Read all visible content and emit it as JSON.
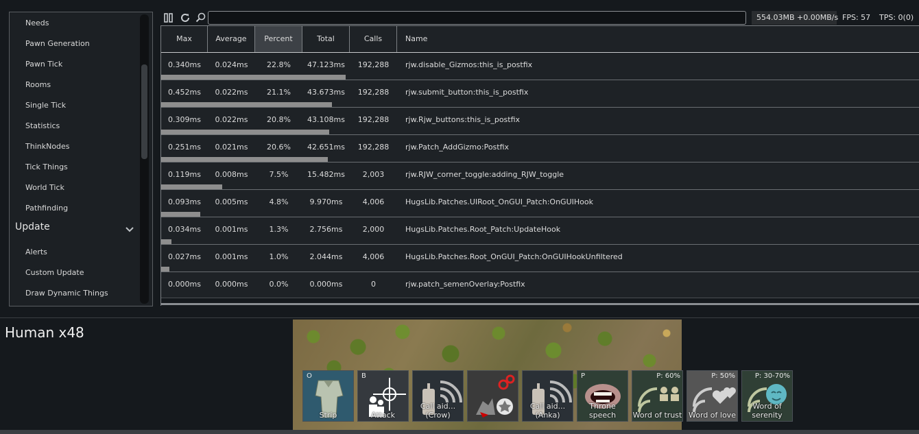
{
  "sidebar": {
    "items_top": [
      "Needs",
      "Pawn Generation",
      "Pawn Tick",
      "Rooms",
      "Single Tick",
      "Statistics",
      "ThinkNodes",
      "Tick Things",
      "World Tick",
      "Pathfinding"
    ],
    "section_header": "Update",
    "items_bottom": [
      "Alerts",
      "Custom Update",
      "Draw Dynamic Things"
    ]
  },
  "toolbar": {
    "search_value": "",
    "memory": "554.03MB +0.00MB/s",
    "fps": "FPS: 57",
    "tps": "TPS: 0(0)"
  },
  "table": {
    "columns": [
      "Max",
      "Average",
      "Percent",
      "Total",
      "Calls",
      "Name"
    ],
    "sorted_column": "Percent",
    "rows": [
      {
        "max": "0.340ms",
        "avg": "0.024ms",
        "pct": "22.8%",
        "total": "47.123ms",
        "calls": "192,288",
        "name": "rjw.disable_Gizmos:this_is_postfix",
        "bar": 22.8
      },
      {
        "max": "0.452ms",
        "avg": "0.022ms",
        "pct": "21.1%",
        "total": "43.673ms",
        "calls": "192,288",
        "name": "rjw.submit_button:this_is_postfix",
        "bar": 21.1
      },
      {
        "max": "0.309ms",
        "avg": "0.022ms",
        "pct": "20.8%",
        "total": "43.108ms",
        "calls": "192,288",
        "name": "rjw.Rjw_buttons:this_is_postfix",
        "bar": 20.8
      },
      {
        "max": "0.251ms",
        "avg": "0.021ms",
        "pct": "20.6%",
        "total": "42.651ms",
        "calls": "192,288",
        "name": "rjw.Patch_AddGizmo:Postfix",
        "bar": 20.6
      },
      {
        "max": "0.119ms",
        "avg": "0.008ms",
        "pct": "7.5%",
        "total": "15.482ms",
        "calls": "2,003",
        "name": "rjw.RJW_corner_toggle:adding_RJW_toggle",
        "bar": 7.5
      },
      {
        "max": "0.093ms",
        "avg": "0.005ms",
        "pct": "4.8%",
        "total": "9.970ms",
        "calls": "4,006",
        "name": "HugsLib.Patches.UIRoot_OnGUI_Patch:OnGUIHook",
        "bar": 4.8
      },
      {
        "max": "0.034ms",
        "avg": "0.001ms",
        "pct": "1.3%",
        "total": "2.756ms",
        "calls": "2,000",
        "name": "HugsLib.Patches.Root_Patch:UpdateHook",
        "bar": 1.3
      },
      {
        "max": "0.027ms",
        "avg": "0.001ms",
        "pct": "1.0%",
        "total": "2.044ms",
        "calls": "4,006",
        "name": "HugsLib.Patches.Root_OnGUI_Patch:OnGUIHookUnfiltered",
        "bar": 1.0
      },
      {
        "max": "0.000ms",
        "avg": "0.000ms",
        "pct": "0.0%",
        "total": "0.000ms",
        "calls": "0",
        "name": "rjw.patch_semenOverlay:Postfix",
        "bar": 0
      }
    ]
  },
  "selection_title": "Human x48",
  "gizmos": [
    {
      "hotkey": "O",
      "cost": "",
      "label": "Strip",
      "icon": "strip-icon"
    },
    {
      "hotkey": "B",
      "cost": "",
      "label": "Attack",
      "icon": "attack-icon"
    },
    {
      "hotkey": "",
      "cost": "",
      "label": "Call aid... (Crow)",
      "icon": "call-aid-icon"
    },
    {
      "hotkey": "",
      "cost": "",
      "label": "",
      "icon": "rjw-icon"
    },
    {
      "hotkey": "",
      "cost": "",
      "label": "Call aid... (Anka)",
      "icon": "call-aid-icon"
    },
    {
      "hotkey": "P",
      "cost": "",
      "label": "Throne speech",
      "icon": "throne-speech-icon"
    },
    {
      "hotkey": "",
      "cost": "P: 60%",
      "label": "Word of trust",
      "icon": "word-of-trust-icon"
    },
    {
      "hotkey": "",
      "cost": "P: 50%",
      "label": "Word of love",
      "icon": "word-of-love-icon"
    },
    {
      "hotkey": "",
      "cost": "P: 30-70%",
      "label": "Word of serenity",
      "icon": "word-of-serenity-icon"
    }
  ],
  "colors": {
    "bar": "#8e8e8e",
    "selected_header": "#3d4146",
    "gizmo_bg": "#2a3036"
  }
}
